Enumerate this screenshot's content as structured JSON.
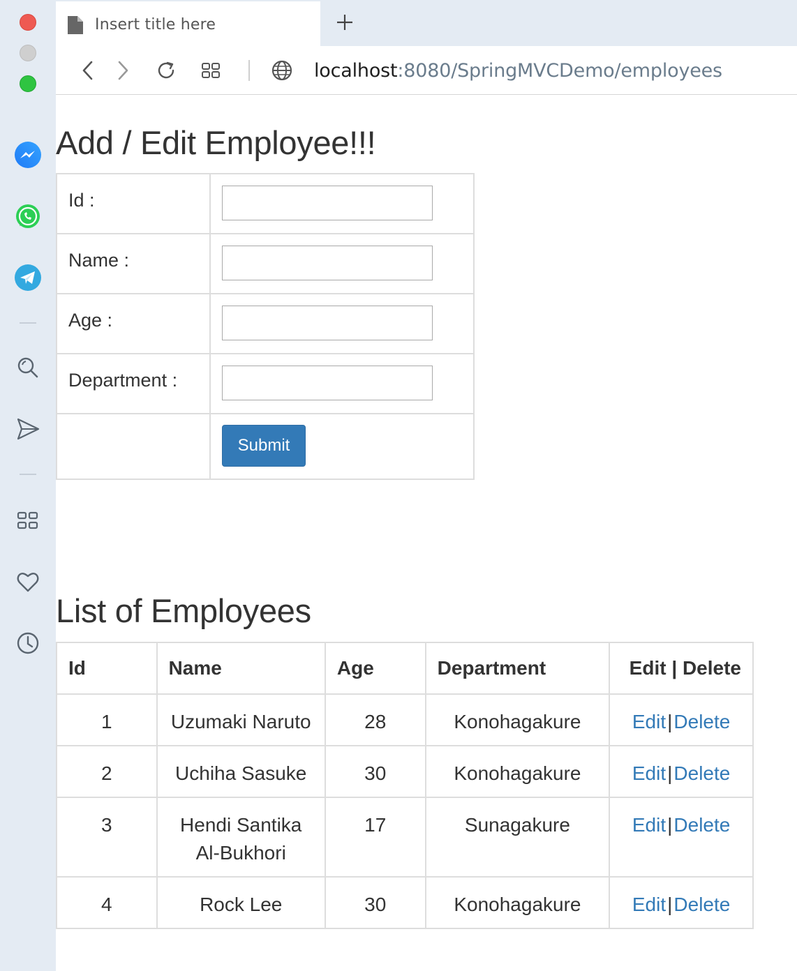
{
  "browser": {
    "tab_title": "Insert title here",
    "url_host": "localhost",
    "url_rest": ":8080/SpringMVCDemo/employees"
  },
  "sidebar": {
    "icons": [
      "messenger-icon",
      "whatsapp-icon",
      "telegram-icon",
      "search-icon",
      "send-icon",
      "apps-icon",
      "heart-icon",
      "history-icon"
    ]
  },
  "form": {
    "heading": "Add / Edit Employee!!!",
    "fields": [
      {
        "label": "Id :",
        "value": ""
      },
      {
        "label": "Name :",
        "value": ""
      },
      {
        "label": "Age :",
        "value": ""
      },
      {
        "label": "Department :",
        "value": ""
      }
    ],
    "submit_label": "Submit"
  },
  "list": {
    "heading": "List of Employees",
    "columns": [
      "Id",
      "Name",
      "Age",
      "Department",
      "Edit | Delete"
    ],
    "rows": [
      {
        "id": "1",
        "name": "Uzumaki Naruto",
        "age": "28",
        "department": "Konohagakure",
        "edit": "Edit",
        "delete": "Delete"
      },
      {
        "id": "2",
        "name": "Uchiha Sasuke",
        "age": "30",
        "department": "Konohagakure",
        "edit": "Edit",
        "delete": "Delete"
      },
      {
        "id": "3",
        "name_line1": "Hendi Santika",
        "name_line2": "Al-Bukhori",
        "age": "17",
        "department": "Sunagakure",
        "edit": "Edit",
        "delete": "Delete"
      },
      {
        "id": "4",
        "name": "Rock Lee",
        "age": "30",
        "department": "Konohagakure",
        "edit": "Edit",
        "delete": "Delete"
      }
    ],
    "separator": "|"
  },
  "colors": {
    "link": "#337ab7",
    "button": "#337ab7",
    "sidebar_bg": "#e4ebf3",
    "border": "#dddddd"
  }
}
